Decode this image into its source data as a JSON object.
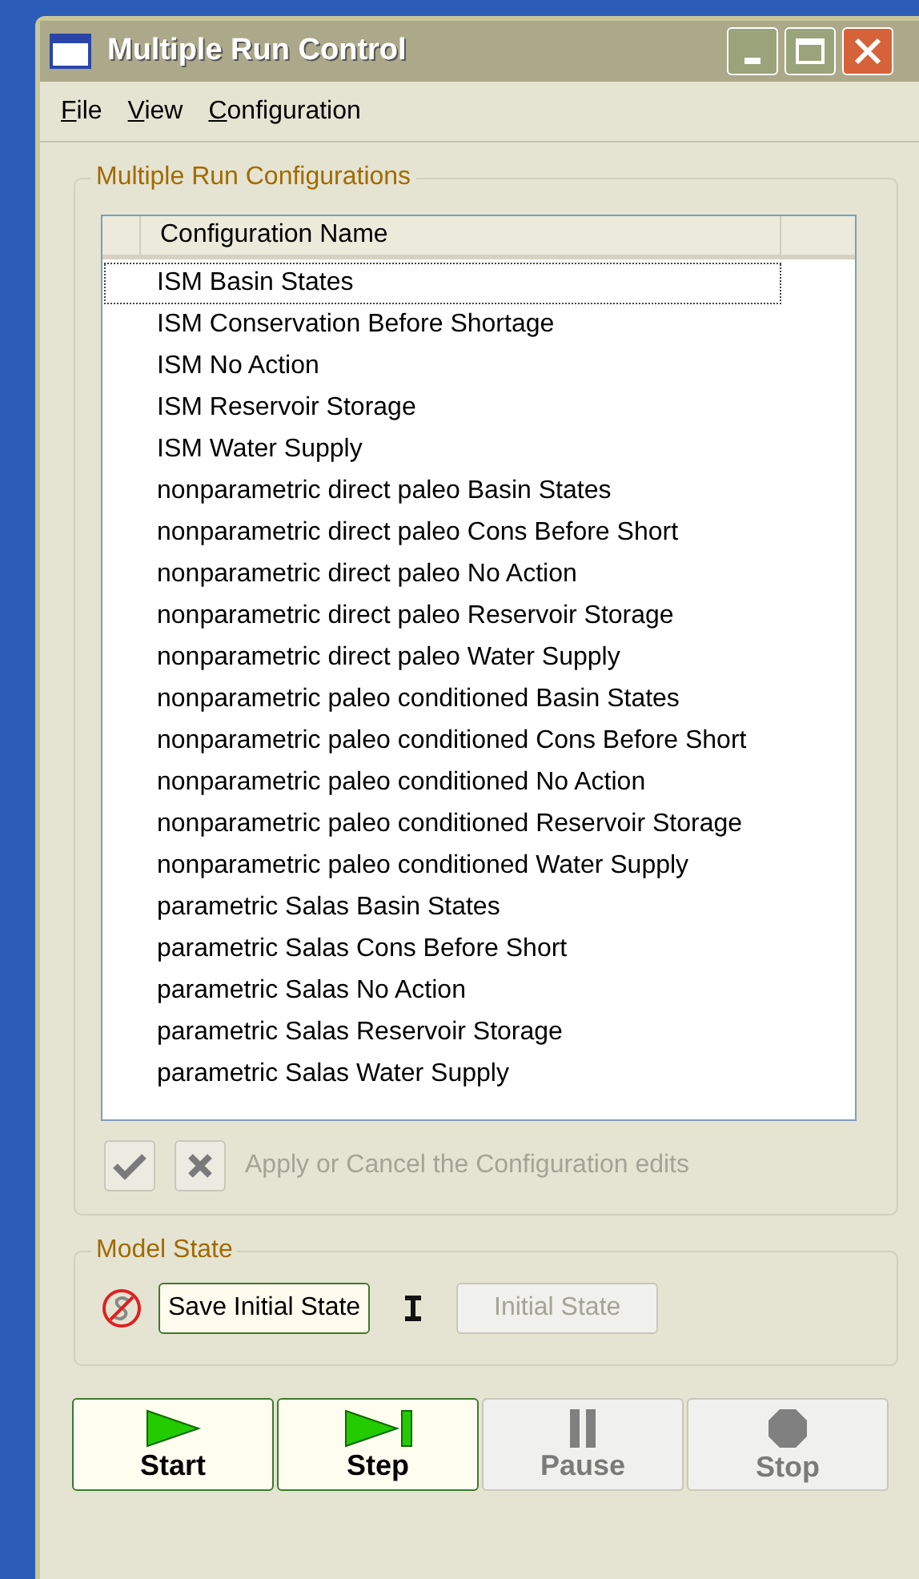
{
  "window": {
    "title": "Multiple Run Control"
  },
  "menu": [
    {
      "access_key": "F",
      "rest": "ile"
    },
    {
      "access_key": "V",
      "rest": "iew"
    },
    {
      "access_key": "C",
      "rest": "onfiguration"
    }
  ],
  "configurations": {
    "title": "Multiple Run Configurations",
    "column": "Configuration Name",
    "rows": [
      {
        "name": "ISM Basin States",
        "focused": true
      },
      {
        "name": "ISM Conservation Before Shortage",
        "focused": false
      },
      {
        "name": "ISM No Action",
        "focused": false
      },
      {
        "name": "ISM Reservoir Storage",
        "focused": false
      },
      {
        "name": "ISM Water Supply",
        "focused": false
      },
      {
        "name": "nonparametric direct paleo Basin States",
        "focused": false
      },
      {
        "name": "nonparametric direct paleo Cons Before Short",
        "focused": false
      },
      {
        "name": "nonparametric direct paleo No Action",
        "focused": false
      },
      {
        "name": "nonparametric direct paleo Reservoir Storage",
        "focused": false
      },
      {
        "name": "nonparametric direct paleo Water Supply",
        "focused": false
      },
      {
        "name": "nonparametric paleo conditioned Basin States",
        "focused": false
      },
      {
        "name": "nonparametric paleo conditioned Cons Before Short",
        "focused": false
      },
      {
        "name": "nonparametric paleo conditioned No Action",
        "focused": false
      },
      {
        "name": "nonparametric paleo conditioned Reservoir Storage",
        "focused": false
      },
      {
        "name": "nonparametric paleo conditioned Water Supply",
        "focused": false
      },
      {
        "name": "parametric Salas Basin States",
        "focused": false
      },
      {
        "name": "parametric Salas Cons Before Short",
        "focused": false
      },
      {
        "name": "parametric Salas No Action",
        "focused": false
      },
      {
        "name": "parametric Salas Reservoir Storage",
        "focused": false
      },
      {
        "name": "parametric Salas Water Supply",
        "focused": false
      }
    ],
    "apply_disabled": true,
    "cancel_disabled": true,
    "hint": "Apply or Cancel the Configuration edits"
  },
  "model_state": {
    "title": "Model State",
    "save_button": {
      "label": "Save Initial State",
      "disabled": false
    },
    "initial_button": {
      "label": "Initial State",
      "disabled": true
    }
  },
  "run_buttons": [
    {
      "kind": "start",
      "label": "Start",
      "disabled": false
    },
    {
      "kind": "step",
      "label": "Step",
      "disabled": false
    },
    {
      "kind": "pause",
      "label": "Pause",
      "disabled": true
    },
    {
      "kind": "stop",
      "label": "Stop",
      "disabled": true
    }
  ]
}
